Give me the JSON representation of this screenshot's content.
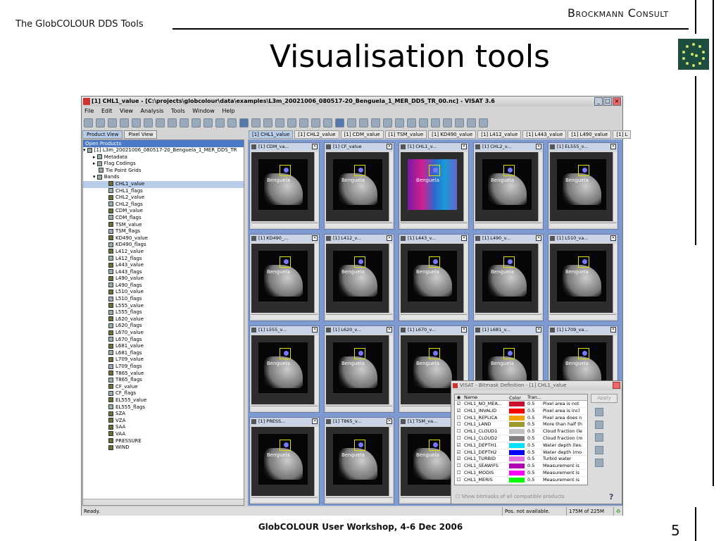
{
  "slide": {
    "subtitle": "The GlobCOLOUR DDS Tools",
    "company": "Brockmann Consult",
    "title": "Visualisation tools",
    "footer": "GlobCOLOUR User Workshop, 4-6 Dec 2006",
    "page_number": "5"
  },
  "app": {
    "window_title": "[1] CHL1_value - [C:\\projects\\globcolour\\data\\examples\\L3m_20021006_080517-20_Benguela_1_MER_DDS_TR_00.nc] - VISAT 3.6",
    "menu": [
      "File",
      "Edit",
      "View",
      "Analysis",
      "Tools",
      "Window",
      "Help"
    ],
    "left_tabs": [
      "Product View",
      "Pixel View"
    ],
    "panel_header": "Open Products",
    "tree_root": "[1] L3m_20021006_080517-20_Benguela_1_MER_DDS_TR",
    "tree_groups": [
      "Metadata",
      "Flag Codings",
      "Tie Point Grids",
      "Bands"
    ],
    "bands": [
      "CHL1_value",
      "CHL1_flags",
      "CHL2_value",
      "CHL2_flags",
      "CDM_value",
      "CDM_flags",
      "TSM_value",
      "TSM_flags",
      "KD490_value",
      "KD490_flags",
      "L412_value",
      "L412_flags",
      "L443_value",
      "L443_flags",
      "L490_value",
      "L490_flags",
      "L510_value",
      "L510_flags",
      "L555_value",
      "L555_flags",
      "L620_value",
      "L620_flags",
      "L670_value",
      "L670_flags",
      "L681_value",
      "L681_flags",
      "L709_value",
      "L709_flags",
      "T865_value",
      "T865_flags",
      "CF_value",
      "CF_flags",
      "EL555_value",
      "EL555_flags",
      "SZA",
      "VZA",
      "SAA",
      "VAA",
      "PRESSURE",
      "WIND"
    ],
    "view_tabs": [
      "[1] CHL1_value",
      "[1] CHL2_value",
      "[1] CDM_value",
      "[1] TSM_value",
      "[1] KD490_value",
      "[1] L412_value",
      "[1] L443_value",
      "[1] L490_value",
      "[1] L"
    ],
    "tiles": [
      "[1] CDM_va...",
      "[1] CF_value",
      "[1] CHL1_v...",
      "[1] CHL2_v...",
      "[1] EL555_v...",
      "[1] KD490_...",
      "[1] L412_v...",
      "[1] L443_v...",
      "[1] L490_v...",
      "[1] L510_va...",
      "[1] L555_v...",
      "[1] L620_v...",
      "[1] L670_v...",
      "[1] L681_v...",
      "[1] L709_va...",
      "[1] PRESS...",
      "[1] T865_v...",
      "[1] TSM_va..."
    ],
    "image_label": "Benguela",
    "status": {
      "ready": "Ready.",
      "pos": "Pos. not available.",
      "memory": "175M of 225M"
    }
  },
  "bitmask": {
    "title": "VISAT - Bitmask Definition - [1] CHL1_value",
    "apply": "Apply",
    "columns": [
      "Name",
      "Color",
      "Tran..."
    ],
    "rows": [
      {
        "name": "CHL1_NO_MEA...",
        "color": "#c8102e",
        "tr": "0.5",
        "desc": "Pixel area is not",
        "checked": true
      },
      {
        "name": "CHL1_INVALID",
        "color": "#ff0000",
        "tr": "0.5",
        "desc": "Pixel area is incl",
        "checked": true
      },
      {
        "name": "CHL1_REPLICA",
        "color": "#f0a000",
        "tr": "0.5",
        "desc": "Pixel area does n",
        "checked": false
      },
      {
        "name": "CHL1_LAND",
        "color": "#9a9a2a",
        "tr": "0.5",
        "desc": "More than half th",
        "checked": false
      },
      {
        "name": "CHL1_CLOUD1",
        "color": "#c0c0c0",
        "tr": "0.5",
        "desc": "Cloud fraction (le",
        "checked": false
      },
      {
        "name": "CHL1_CLOUD2",
        "color": "#808080",
        "tr": "0.5",
        "desc": "Cloud fraction (m",
        "checked": false
      },
      {
        "name": "CHL1_DEPTH1",
        "color": "#00e0ff",
        "tr": "0.5",
        "desc": "Water depth (les:",
        "checked": true
      },
      {
        "name": "CHL1_DEPTH2",
        "color": "#0000ff",
        "tr": "0.5",
        "desc": "Water depth (mo",
        "checked": true
      },
      {
        "name": "CHL1_TURBID",
        "color": "#e070e0",
        "tr": "0.5",
        "desc": "Turbid water",
        "checked": true
      },
      {
        "name": "CHL1_SEAWIFS",
        "color": "#b000b0",
        "tr": "0.5",
        "desc": "Measurement is",
        "checked": false
      },
      {
        "name": "CHL1_MODIS",
        "color": "#ff00ff",
        "tr": "0.5",
        "desc": "Measurement is",
        "checked": false
      },
      {
        "name": "CHL1_MERIS",
        "color": "#00ff00",
        "tr": "0.5",
        "desc": "Measurement is",
        "checked": false
      }
    ],
    "show_all": "Show bitmasks of all compatible products",
    "help": "?"
  }
}
